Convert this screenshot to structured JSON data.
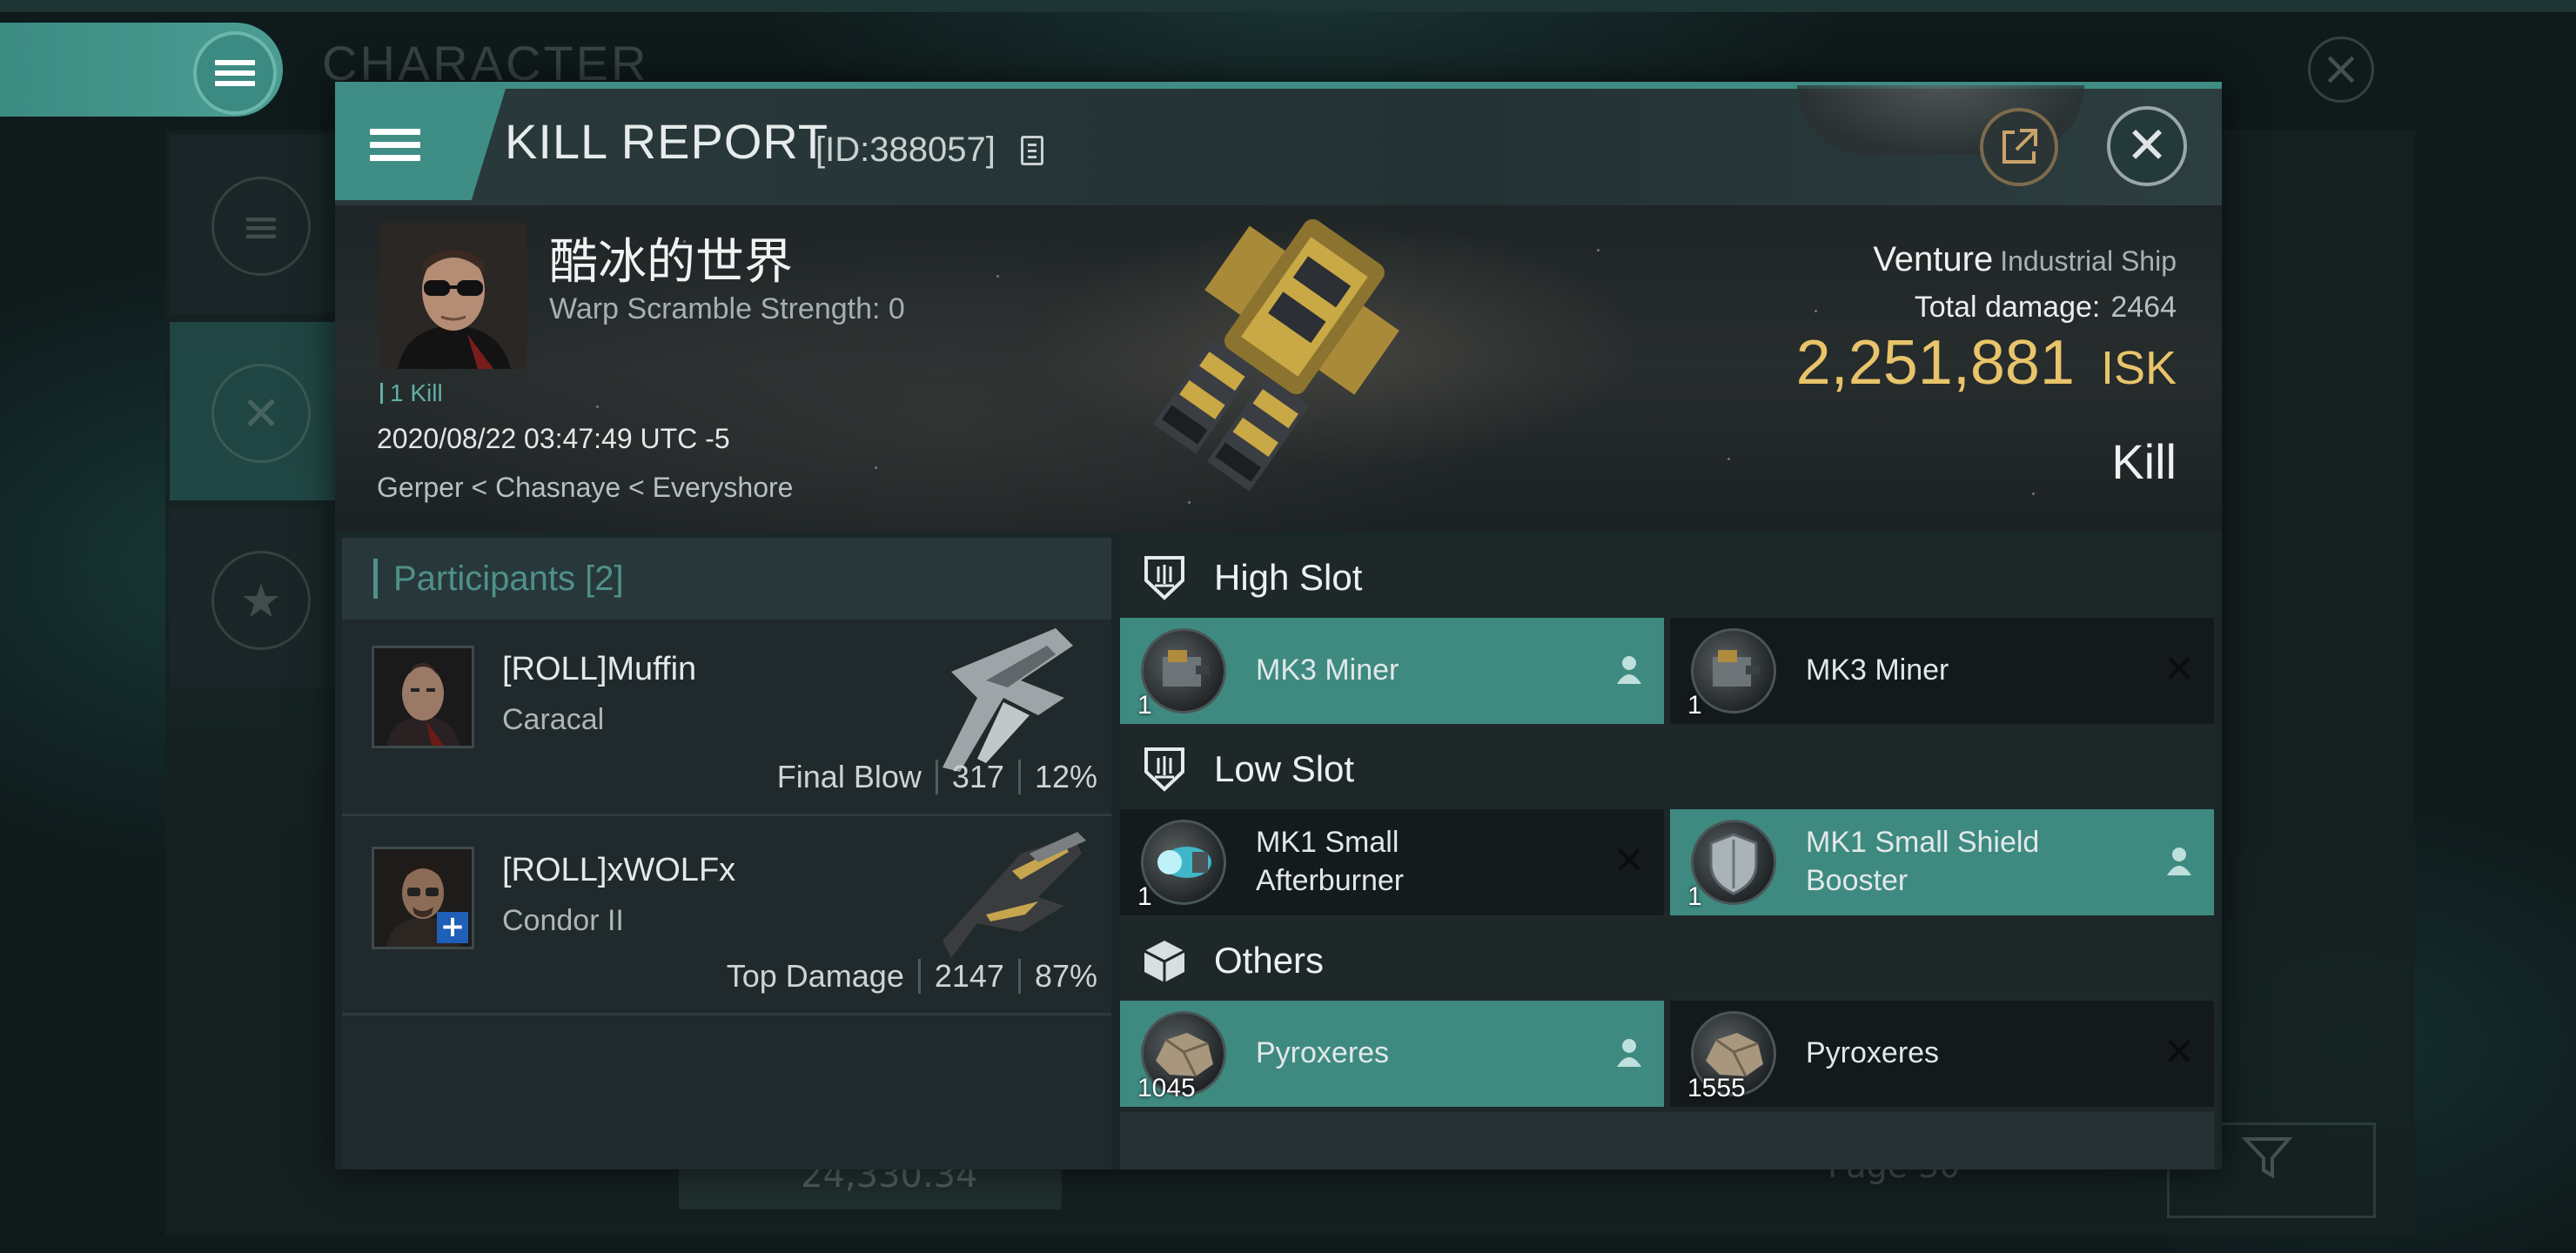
{
  "background_window": {
    "title": "CHARACTER",
    "balance": "24,330.34",
    "page_label": "Page 30"
  },
  "kill_report": {
    "title": "KILL REPORT",
    "id_label": "[ID:388057]",
    "victim": {
      "name": "酷冰的世界",
      "warp_scramble": "Warp Scramble Strength: 0",
      "kills_label": "1 Kill",
      "datetime": "2020/08/22 03:47:49 UTC -5",
      "location": "Gerper < Chasnaye < Everyshore"
    },
    "ship": {
      "name": "Venture",
      "class": "Industrial Ship",
      "total_damage_label": "Total damage:",
      "total_damage": "2464",
      "isk_value": "2,251,881",
      "isk_unit": "ISK",
      "report_type": "Kill"
    },
    "participants": {
      "header": "Participants [2]",
      "items": [
        {
          "name": "[ROLL]Muffin",
          "ship": "Caracal",
          "role": "Final Blow",
          "damage": "317",
          "percent": "12%"
        },
        {
          "name": "[ROLL]xWOLFx",
          "ship": "Condor II",
          "role": "Top Damage",
          "damage": "2147",
          "percent": "87%"
        }
      ]
    },
    "fitting": {
      "high_slot": {
        "label": "High Slot",
        "modules": [
          {
            "name": "MK3 Miner",
            "qty": "1",
            "state": "dropped"
          },
          {
            "name": "MK3 Miner",
            "qty": "1",
            "state": "destroyed"
          }
        ]
      },
      "low_slot": {
        "label": "Low Slot",
        "modules": [
          {
            "name": "MK1 Small Afterburner",
            "qty": "1",
            "state": "destroyed"
          },
          {
            "name": "MK1 Small Shield Booster",
            "qty": "1",
            "state": "dropped"
          }
        ]
      },
      "others": {
        "label": "Others",
        "modules": [
          {
            "name": "Pyroxeres",
            "qty": "1045",
            "state": "dropped"
          },
          {
            "name": "Pyroxeres",
            "qty": "1555",
            "state": "destroyed"
          }
        ]
      }
    }
  },
  "colors": {
    "accent": "#3e8a81",
    "isk": "#e8c46a",
    "panel": "#1b2628"
  }
}
